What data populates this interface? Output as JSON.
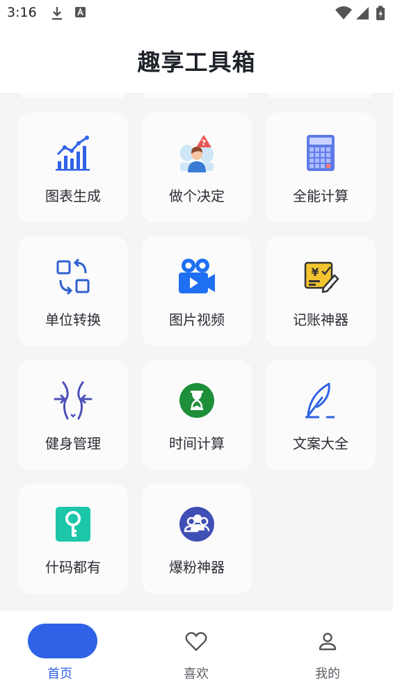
{
  "status_bar": {
    "time": "3:16"
  },
  "header": {
    "title": "趣享工具箱"
  },
  "tools": [
    {
      "label": "图表生成",
      "icon": "chart-icon"
    },
    {
      "label": "做个决定",
      "icon": "decision-icon"
    },
    {
      "label": "全能计算",
      "icon": "calculator-icon"
    },
    {
      "label": "单位转换",
      "icon": "convert-icon"
    },
    {
      "label": "图片视频",
      "icon": "video-camera-icon"
    },
    {
      "label": "记账神器",
      "icon": "bill-icon"
    },
    {
      "label": "健身管理",
      "icon": "body-icon"
    },
    {
      "label": "时间计算",
      "icon": "hourglass-icon"
    },
    {
      "label": "文案大全",
      "icon": "feather-icon"
    },
    {
      "label": "什码都有",
      "icon": "key-icon"
    },
    {
      "label": "爆粉神器",
      "icon": "users-icon"
    }
  ],
  "tabs": [
    {
      "label": "首页",
      "icon": "home-icon",
      "active": true
    },
    {
      "label": "喜欢",
      "icon": "heart-icon",
      "active": false
    },
    {
      "label": "我的",
      "icon": "profile-icon",
      "active": false
    }
  ],
  "colors": {
    "accent": "#2f62e6",
    "background": "#f4f5f7",
    "card": "#fbfbfc"
  }
}
